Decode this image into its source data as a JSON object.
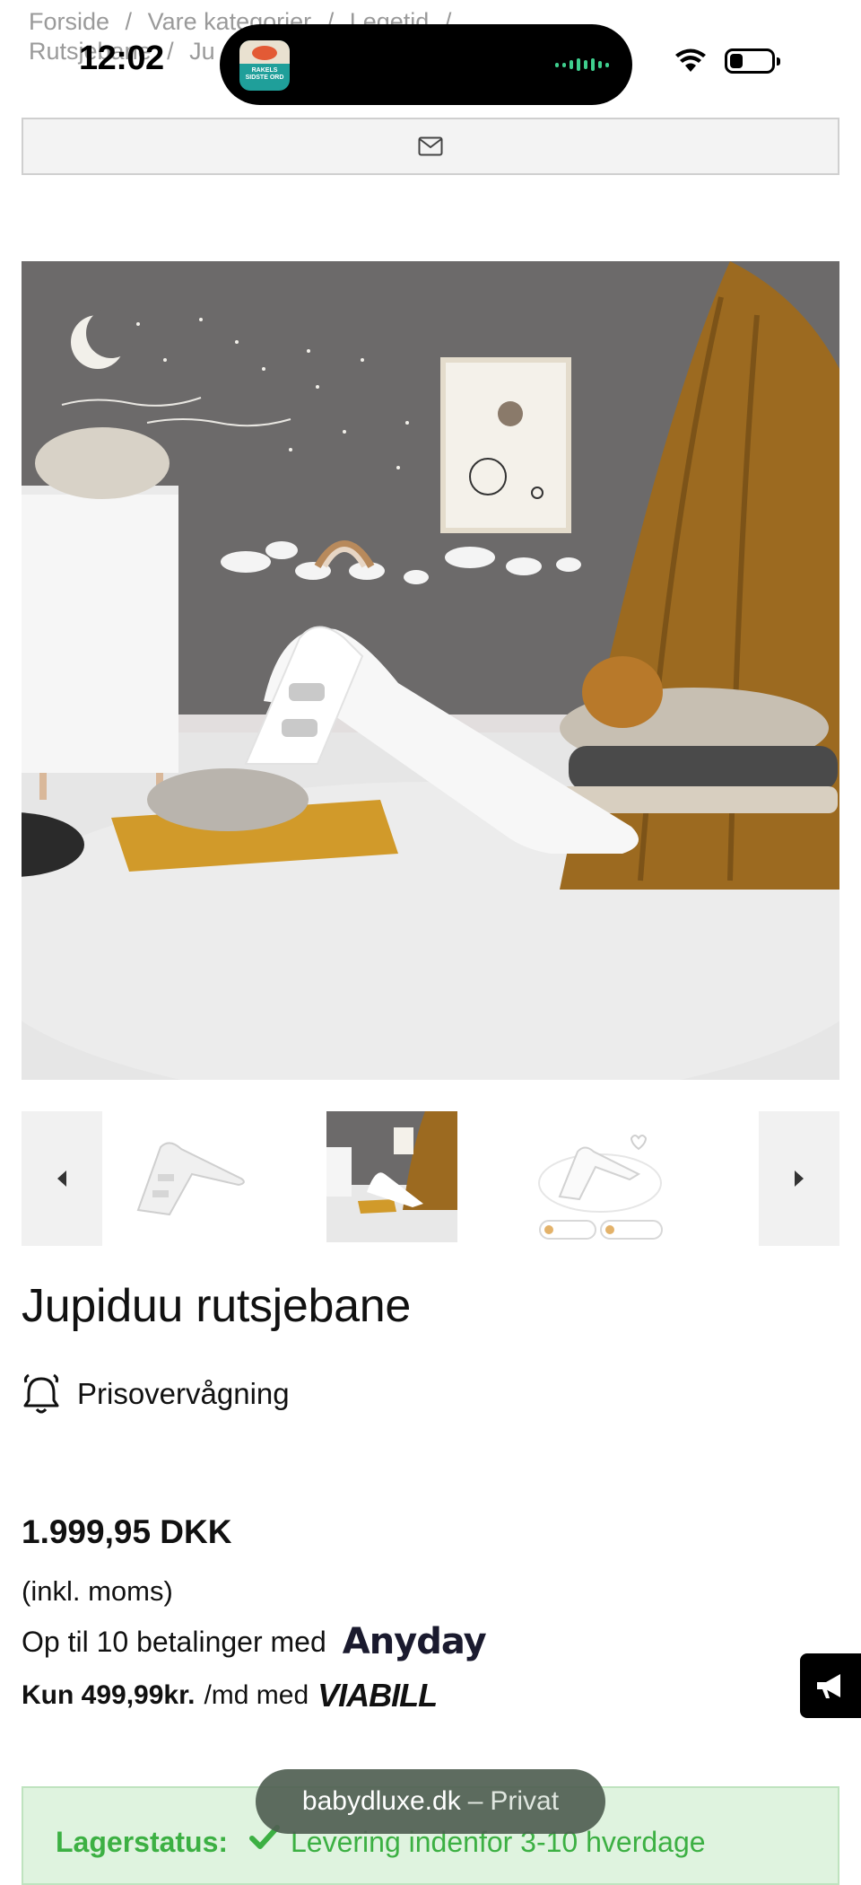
{
  "status_bar": {
    "time": "12:02",
    "island_app_text": "RAKELS SIDSTE ORD"
  },
  "breadcrumb": {
    "items": [
      "Forside",
      "Vare kategorier",
      "Legetid",
      "Rutsjebane",
      "Ju"
    ],
    "separator": "/"
  },
  "contact": {
    "icon": "envelope-icon"
  },
  "gallery": {
    "hero_alt": "Hvid rutsjebane i børneværelse",
    "prev_icon": "caret-left-icon",
    "next_icon": "caret-right-icon"
  },
  "product": {
    "title": "Jupiduu rutsjebane",
    "price_watch_label": "Prisovervågning",
    "price": "1.999,95 DKK",
    "vat_note": "(inkl. moms)",
    "anyday_text": "Op til 10 betalinger med",
    "anyday_logo": "Anyday",
    "viabill_amount": "Kun 499,99kr.",
    "viabill_text": "/md med",
    "viabill_logo": "VIABILL"
  },
  "stock": {
    "label": "Lagerstatus:",
    "text": "Levering indenfor 3-10 hverdage"
  },
  "browser_toast": {
    "domain": "babydluxe.dk",
    "separator": "–",
    "mode": "Privat"
  },
  "colors": {
    "stock_green": "#3cb043",
    "stock_bg": "#dff3df",
    "toast_bg": "#506052"
  }
}
